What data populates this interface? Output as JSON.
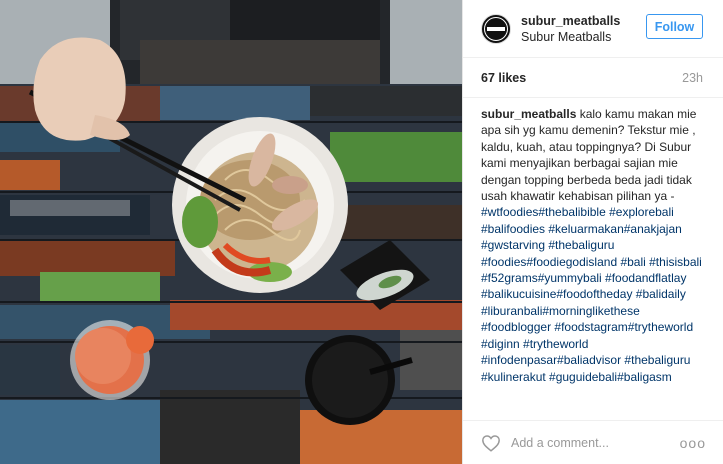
{
  "header": {
    "username": "subur_meatballs",
    "fullname": "Subur Meatballs",
    "follow_label": "Follow",
    "avatar_icon": "subur-meatballs-logo"
  },
  "meta": {
    "likes": "67 likes",
    "time": "23h"
  },
  "caption": {
    "username": "subur_meatballs",
    "text": " kalo kamu makan mie apa sih yg kamu demenin? Tekstur mie , kaldu, kuah, atau toppingnya? Di Subur kami menyajikan berbagai sajian mie dengan topping berbeda beda jadi tidak usah khawatir kehabisan pilihan ya - ",
    "tags": "#wtfoodies#thebalibible #explorebali #balifoodies #keluarmakan#anakjajan #gwstarving #thebaliguru #foodies#foodiegodisland #bali #thisisbali #f52grams#yummybali #foodandflatlay #balikucuisine#foodoftheday #balidaily #liburanbali#morninglikethese #foodblogger #foodstagram#trytheworld #diginn #trytheworld #infodenpasar#baliadvisor #thebaliguru #kulinerakut #guguidebali#baligasm"
  },
  "footer": {
    "comment_placeholder": "Add a comment...",
    "more_label": "ooo"
  },
  "colors": {
    "accent": "#3897f0",
    "hashtag": "#003569",
    "muted": "#999999"
  }
}
